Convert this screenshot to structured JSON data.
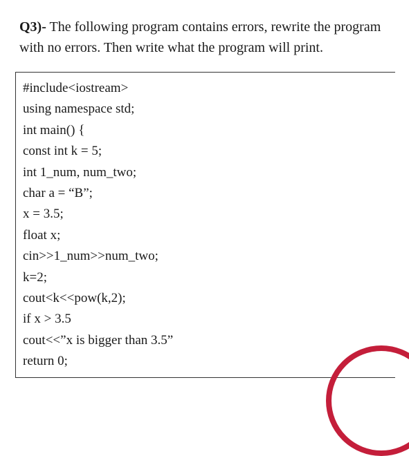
{
  "question": {
    "label": "Q3)-",
    "text": " The following program contains errors, rewrite the program with no errors. Then write what the program will print."
  },
  "code": {
    "lines": [
      "#include<iostream>",
      "using namespace std;",
      "int main() {",
      "const int k = 5;",
      "int 1_num, num_two;",
      "char a = “B”;",
      "x = 3.5;",
      "float x;",
      "cin>>1_num>>num_two;",
      "k=2;",
      "cout<k<<pow(k,2);",
      "if x > 3.5",
      "cout<<”x is bigger than 3.5”",
      "return 0;"
    ]
  }
}
